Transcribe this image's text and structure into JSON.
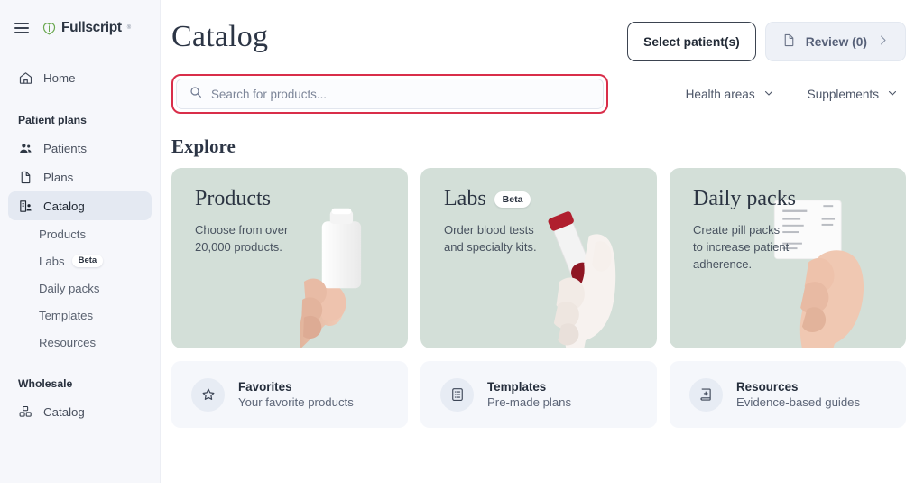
{
  "brand": {
    "name": "Fullscript",
    "tm": "®",
    "logo_color": "#6aa84f",
    "menu_icon": "hamburger-icon"
  },
  "sidebar": {
    "home": {
      "label": "Home",
      "icon": "home-icon"
    },
    "patient_plans_label": "Patient plans",
    "patient_plans_items": [
      {
        "label": "Patients",
        "icon": "people-icon",
        "active": false
      },
      {
        "label": "Plans",
        "icon": "document-icon",
        "active": false
      },
      {
        "label": "Catalog",
        "icon": "catalog-icon",
        "active": true
      }
    ],
    "catalog_subitems": [
      {
        "label": "Products",
        "badge": ""
      },
      {
        "label": "Labs",
        "badge": "Beta"
      },
      {
        "label": "Daily packs",
        "badge": ""
      },
      {
        "label": "Templates",
        "badge": ""
      },
      {
        "label": "Resources",
        "badge": ""
      }
    ],
    "wholesale_label": "Wholesale",
    "wholesale_items": [
      {
        "label": "Catalog",
        "icon": "boxes-icon"
      }
    ]
  },
  "header": {
    "title": "Catalog",
    "select_patients_label": "Select patient(s)",
    "review_label": "Review (0)",
    "review_icon": "document-icon",
    "review_chevron": "chevron-right-icon"
  },
  "search": {
    "placeholder": "Search for products...",
    "value": "",
    "icon": "search-icon",
    "highlight_color": "#d92e4a"
  },
  "filters": [
    {
      "label": "Health areas",
      "icon": "chevron-down-icon"
    },
    {
      "label": "Supplements",
      "icon": "chevron-down-icon"
    }
  ],
  "explore": {
    "heading": "Explore",
    "cards": [
      {
        "title": "Products",
        "badge": "",
        "description": "Choose from over 20,000 products.",
        "bg": "#d3dfd8",
        "art": "hand-holding-supplement-bottle"
      },
      {
        "title": "Labs",
        "badge": "Beta",
        "description": "Order blood tests and specialty kits.",
        "bg": "#d3dfd8",
        "art": "gloved-hand-holding-blood-vial"
      },
      {
        "title": "Daily packs",
        "badge": "",
        "description": "Create pill packs to increase patient adherence.",
        "bg": "#d3dfd8",
        "art": "hand-holding-pill-sachet"
      }
    ],
    "quick_links": [
      {
        "title": "Favorites",
        "subtitle": "Your favorite products",
        "icon": "star-icon"
      },
      {
        "title": "Templates",
        "subtitle": "Pre-made plans",
        "icon": "list-icon"
      },
      {
        "title": "Resources",
        "subtitle": "Evidence-based guides",
        "icon": "book-plus-icon"
      }
    ]
  }
}
